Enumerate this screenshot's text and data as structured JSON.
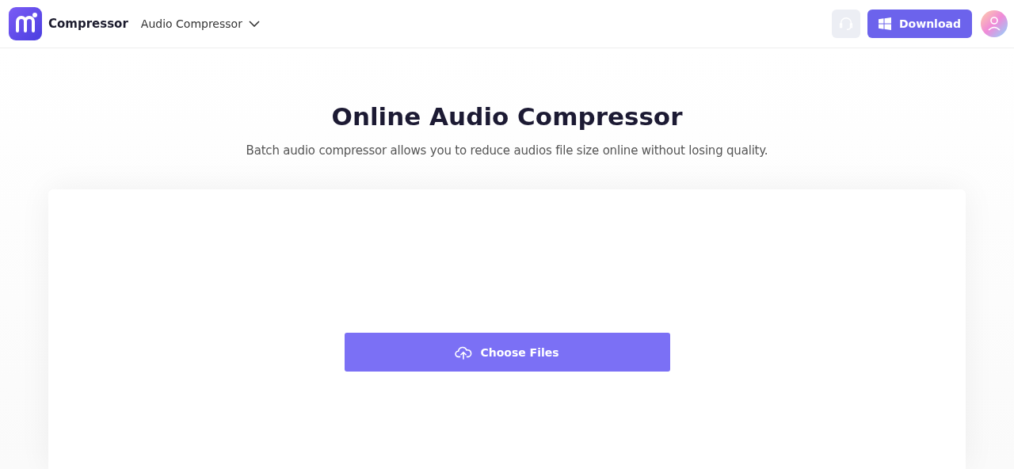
{
  "header": {
    "brand": "Compressor",
    "tool_menu": "Audio Compressor",
    "download_button": "Download"
  },
  "hero": {
    "title": "Online Audio Compressor",
    "subtitle": "Batch audio compressor allows you to reduce audios file size online without losing quality."
  },
  "upload": {
    "button": "Choose Files"
  }
}
